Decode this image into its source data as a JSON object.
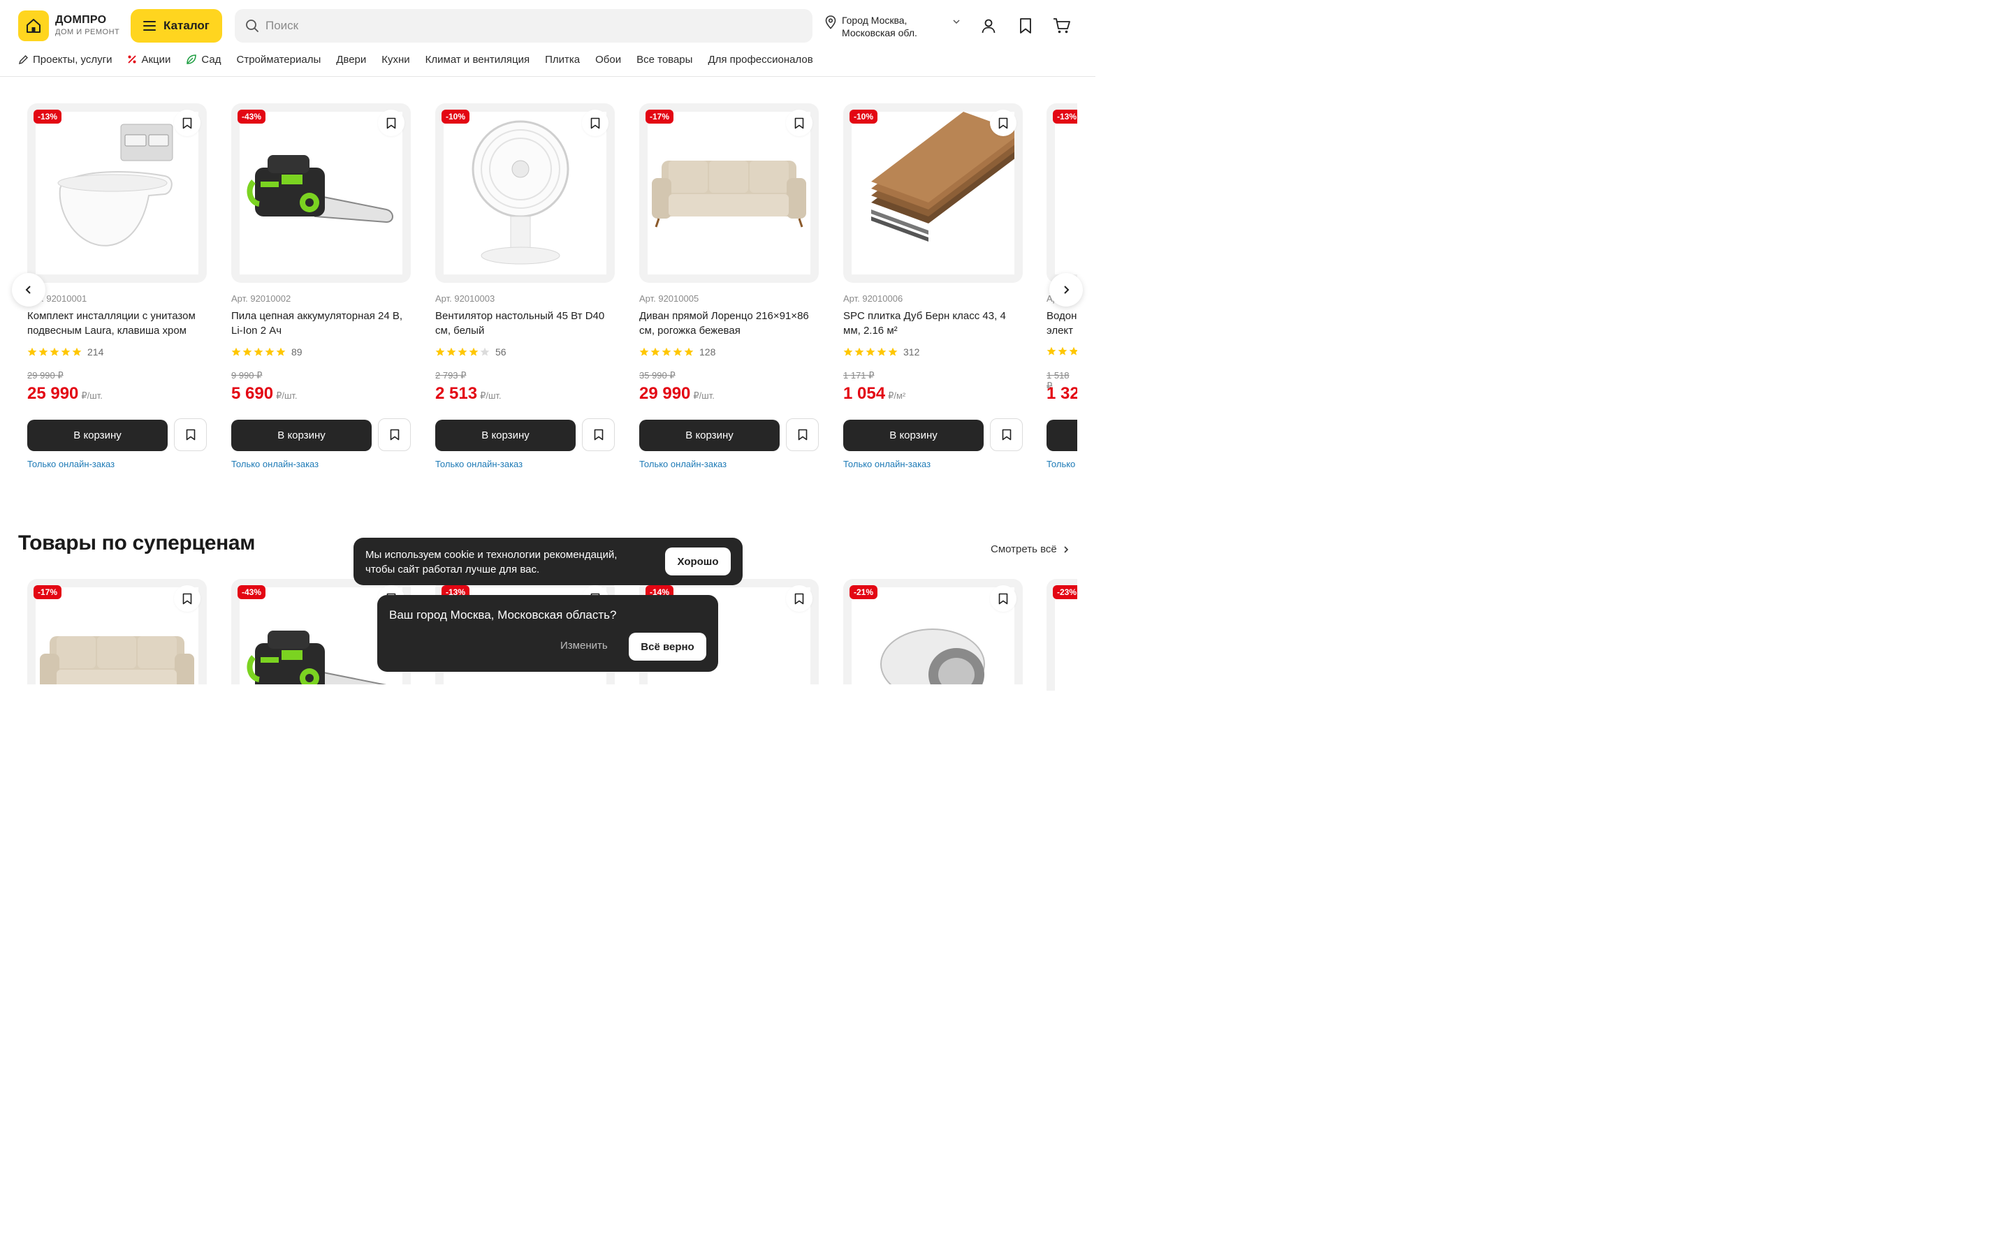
{
  "header": {
    "logo_name": "ДОМПРО",
    "logo_sub": "ДОМ И РЕМОНТ",
    "catalog_label": "Каталог",
    "search_placeholder": "Поиск",
    "city_line1": "Город Москва,",
    "city_line2": "Московская обл."
  },
  "nav": [
    {
      "label": "Проекты, услуги",
      "icon": "pencil-icon"
    },
    {
      "label": "Акции",
      "icon": "percent-icon"
    },
    {
      "label": "Сад",
      "icon": "leaf-icon"
    },
    {
      "label": "Стройматериалы"
    },
    {
      "label": "Двери"
    },
    {
      "label": "Кухни"
    },
    {
      "label": "Климат и вентиляция"
    },
    {
      "label": "Плитка"
    },
    {
      "label": "Обои"
    },
    {
      "label": "Все товары"
    },
    {
      "label": "Для профессионалов"
    }
  ],
  "section1": {
    "see_all": "Смотреть всё",
    "products": [
      {
        "badge": "-13%",
        "art": "Арт. 92010001",
        "name": "Комплект инсталляции с унитазом подвесным Laura, клавиша хром",
        "rating": 5,
        "reviews": "214",
        "old_price": "29 990 ₽",
        "price": "25 990",
        "unit": "₽/шт.",
        "cart": "В корзину",
        "note": "Только онлайн-заказ"
      },
      {
        "badge": "-43%",
        "art": "Арт. 92010002",
        "name": "Пила цепная аккумуляторная 24 В, Li-Ion 2 Ач",
        "rating": 5,
        "reviews": "89",
        "old_price": "9 990 ₽",
        "price": "5 690",
        "unit": "₽/шт.",
        "cart": "В корзину",
        "note": "Только онлайн-заказ"
      },
      {
        "badge": "-10%",
        "art": "Арт. 92010003",
        "name": "Вентилятор настольный 45 Вт D40 см, белый",
        "rating": 4,
        "reviews": "56",
        "old_price": "2 793 ₽",
        "price": "2 513",
        "unit": "₽/шт.",
        "cart": "В корзину",
        "note": "Только онлайн-заказ"
      },
      {
        "badge": "-17%",
        "art": "Арт. 92010005",
        "name": "Диван прямой Лоренцо 216×91×86 см, рогожка бежевая",
        "rating": 5,
        "reviews": "128",
        "old_price": "35 990 ₽",
        "price": "29 990",
        "unit": "₽/шт.",
        "cart": "В корзину",
        "note": "Только онлайн-заказ"
      },
      {
        "badge": "-10%",
        "art": "Арт. 92010006",
        "name": "SPC плитка Дуб Берн класс 43, 4 мм, 2.16 м²",
        "rating": 5,
        "reviews": "312",
        "old_price": "1 171 ₽",
        "price": "1 054",
        "unit": "₽/м²",
        "cart": "В корзину",
        "note": "Только онлайн-заказ"
      }
    ],
    "partial": {
      "badge": "-13%",
      "art": "Ар",
      "name1": "Водон",
      "name2": "элект",
      "old_price": "1 518 ₽",
      "price": "1 32",
      "note": "Только"
    }
  },
  "section2": {
    "title": "Товары по суперценам",
    "see_all": "Смотреть всё",
    "badges": [
      "-17%",
      "-43%",
      "-13%",
      "-14%",
      "-21%",
      "-23%"
    ]
  },
  "cookie": {
    "text": "Мы используем cookie и технологии рекомендаций, чтобы сайт работал лучше для вас.",
    "button": "Хорошо"
  },
  "city_confirm": {
    "question": "Ваш город Москва, Московская область?",
    "change": "Изменить",
    "confirm": "Всё верно"
  },
  "colors": {
    "brand_yellow": "#ffd51f",
    "discount_red": "#e30613",
    "dark_button": "#262626",
    "link_blue": "#1d7ab6",
    "star_yellow": "#ffc700"
  }
}
